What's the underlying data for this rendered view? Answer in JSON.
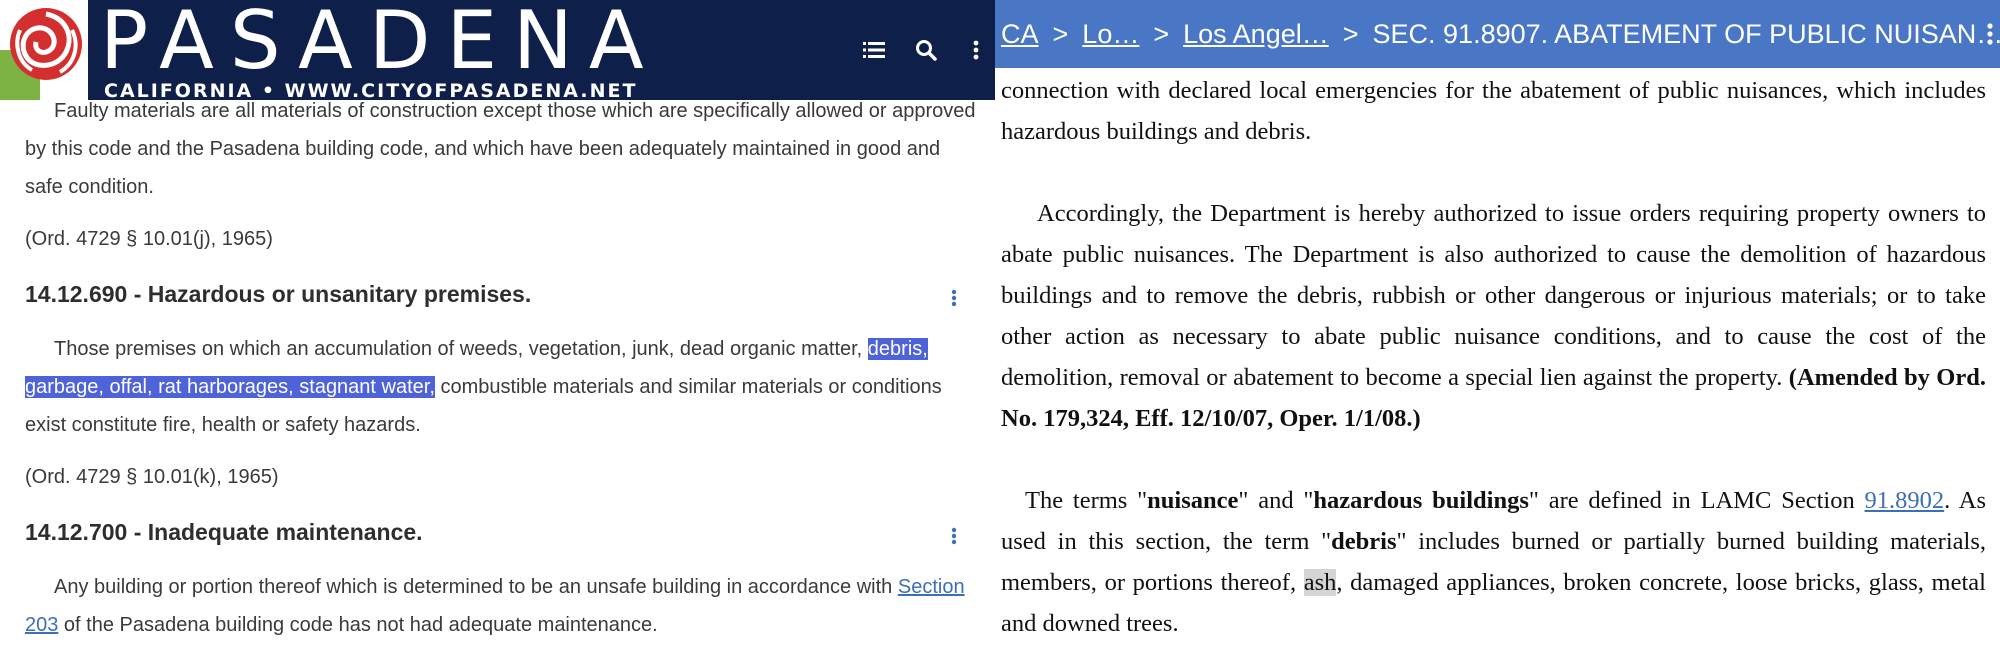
{
  "left": {
    "header": {
      "title": "PASADENA",
      "subtitle": "CALIFORNIA • WWW.CITYOFPASADENA.NET",
      "icons": [
        "list-icon",
        "search-icon",
        "more-vertical-icon"
      ]
    },
    "intro_text": "Faulty materials are all materials of construction except those which are specifically allowed or approved by this code and the Pasadena building code, and which have been adequately maintained in good and safe condition.",
    "intro_citation": "(Ord. 4729 § 10.01(j), 1965)",
    "sections": [
      {
        "title": "14.12.690 - Hazardous or unsanitary premises.",
        "body_before": "Those premises on which an accumulation of weeds, vegetation, junk, dead organic matter, ",
        "body_highlight": "debris, garbage, offal, rat harborages, stagnant water,",
        "body_after": " combustible materials and similar materials or conditions exist constitute fire, health or safety hazards.",
        "citation": "(Ord. 4729 § 10.01(k), 1965)"
      },
      {
        "title": "14.12.700 - Inadequate maintenance.",
        "body_before": "Any building or portion thereof which is determined to be an unsafe building in accordance with ",
        "link": "Section 203",
        "body_after": " of the Pasadena building code has not had adequate maintenance."
      }
    ]
  },
  "right": {
    "breadcrumb": {
      "items": [
        "CA",
        "Lo…",
        "Los Angel…"
      ],
      "separator": ">",
      "current": "SEC. 91.8907. ABATEMENT OF PUBLIC NUISAN…"
    },
    "p1": "connection with declared local emergencies for the abatement of public nuisances, which includes hazardous buildings and debris.",
    "p2_text": "Accordingly, the Department is hereby authorized to issue orders requiring property owners to abate public nuisances. The Department is also authorized to cause the demolition of hazardous buildings and to remove the debris, rubbish or other dangerous or injurious materials; or to take other action as necessary to abate public nuisance conditions, and to cause the cost of the demolition, removal or abatement to become a special lien against the property. ",
    "p2_bold": "(Amended by Ord. No. 179,324, Eff. 12/10/07, Oper. 1/1/08.)",
    "p3": {
      "t1": "The terms \"",
      "b1": "nuisance",
      "t2": "\" and \"",
      "b2": "hazardous buildings",
      "t3": "\" are defined in LAMC Section ",
      "link": "91.8902",
      "t4": ". As used in this section, the term \"",
      "b3": "debris",
      "t5": "\" includes burned or partially burned building materials, members, or portions thereof, ",
      "hl": "ash",
      "t6": ", damaged appliances, broken concrete, loose bricks, glass, metal and downed trees."
    }
  },
  "colors": {
    "left_header_bg": "#0e1f4a",
    "right_header_bg": "#4a76c6",
    "selection_highlight": "#4e63d8",
    "link": "#3b6fb6",
    "search_highlight": "#d4d4d4"
  }
}
